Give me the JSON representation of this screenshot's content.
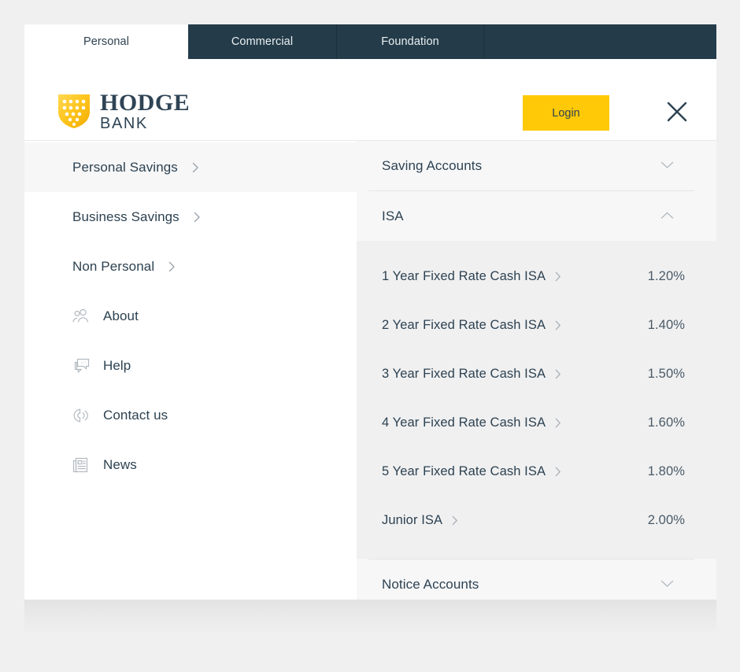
{
  "theme": {
    "brand_yellow": "#ffc907",
    "dark_navy": "#243c49",
    "text_navy": "#2d4251",
    "panel_bg": "#f7f7f8",
    "panel_expanded_bg": "#f0f0f1",
    "page_bg": "#f0f0f0"
  },
  "tabs": [
    {
      "label": "Personal",
      "active": true
    },
    {
      "label": "Commercial",
      "active": false
    },
    {
      "label": "Foundation",
      "active": false
    }
  ],
  "header": {
    "logo_name": "HODGE",
    "logo_sub": "BANK",
    "login_label": "Login",
    "close_icon": "close-icon"
  },
  "sidebar": {
    "nav_items": [
      {
        "label": "Personal Savings",
        "icon": "chevron-right-icon",
        "active": true
      },
      {
        "label": "Business Savings",
        "icon": "chevron-right-icon",
        "active": false
      },
      {
        "label": "Non Personal",
        "icon": "chevron-right-icon",
        "active": false
      }
    ],
    "icon_items": [
      {
        "label": "About",
        "icon": "people-icon"
      },
      {
        "label": "Help",
        "icon": "chat-bubbles-icon"
      },
      {
        "label": "Contact us",
        "icon": "phone-ringing-icon"
      },
      {
        "label": "News",
        "icon": "newspaper-icon"
      }
    ]
  },
  "panel": {
    "sections": [
      {
        "title": "Saving Accounts",
        "expanded": false,
        "toggle_icon": "chevron-down-icon",
        "items": []
      },
      {
        "title": "ISA",
        "expanded": true,
        "toggle_icon": "chevron-up-icon",
        "items": [
          {
            "name": "1 Year Fixed Rate Cash ISA",
            "rate": "1.20%",
            "icon": "chevron-right-icon"
          },
          {
            "name": "2 Year Fixed Rate Cash ISA",
            "rate": "1.40%",
            "icon": "chevron-right-icon"
          },
          {
            "name": "3 Year Fixed Rate Cash ISA",
            "rate": "1.50%",
            "icon": "chevron-right-icon"
          },
          {
            "name": "4 Year Fixed Rate Cash ISA",
            "rate": "1.60%",
            "icon": "chevron-right-icon"
          },
          {
            "name": "5 Year Fixed Rate Cash ISA",
            "rate": "1.80%",
            "icon": "chevron-right-icon"
          },
          {
            "name": "Junior ISA",
            "rate": "2.00%",
            "icon": "chevron-right-icon"
          }
        ]
      },
      {
        "title": "Notice Accounts",
        "expanded": false,
        "toggle_icon": "chevron-down-icon",
        "items": []
      }
    ]
  }
}
